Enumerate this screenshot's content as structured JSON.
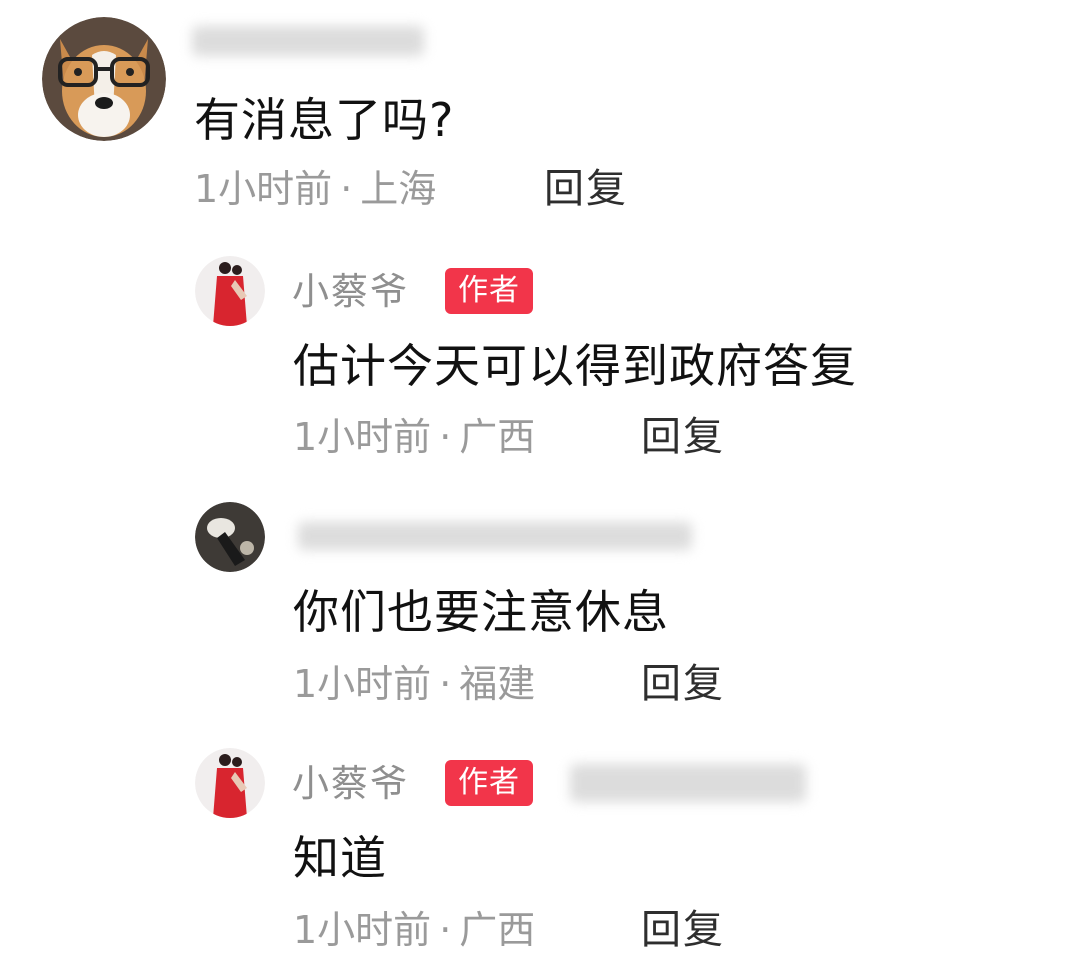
{
  "comments": [
    {
      "avatar": "corgi-with-glasses-avatar",
      "username": "",
      "text": "有消息了吗?",
      "time": "1小时前",
      "separator": "·",
      "location": "上海",
      "reply_label": "回复"
    },
    {
      "avatar": "woman-in-red-dress-avatar",
      "username": "小蔡爷",
      "badge": "作者",
      "text": "估计今天可以得到政府答复",
      "time": "1小时前",
      "separator": "·",
      "location": "广西",
      "reply_label": "回复"
    },
    {
      "avatar": "dark-figure-avatar",
      "username": "",
      "text": "你们也要注意休息",
      "time": "1小时前",
      "separator": "·",
      "location": "福建",
      "reply_label": "回复"
    },
    {
      "avatar": "woman-in-red-dress-avatar",
      "username": "小蔡爷",
      "badge": "作者",
      "text": "知道",
      "time": "1小时前",
      "separator": "·",
      "location": "广西",
      "reply_label": "回复"
    }
  ],
  "colors": {
    "badge": "#f2354a",
    "username": "#8f8f8f",
    "meta": "#9a9a9a",
    "text": "#111111"
  }
}
